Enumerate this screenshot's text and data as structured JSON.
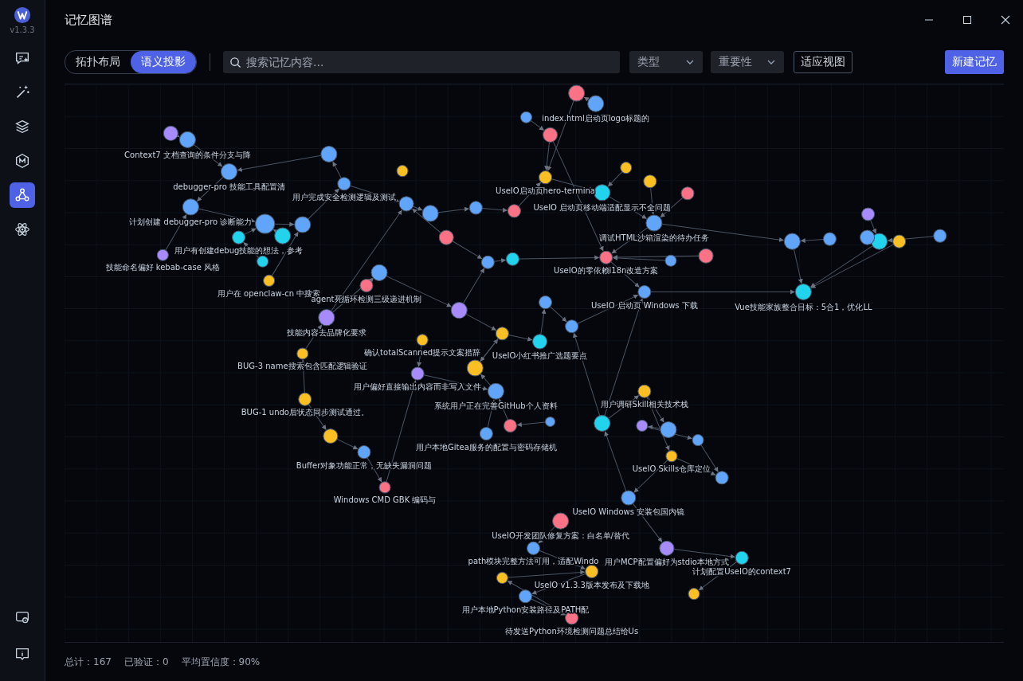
{
  "app": {
    "version": "v1.3.3"
  },
  "sidebar": {
    "items": [
      {
        "kind": "chat",
        "selected": false
      },
      {
        "kind": "wand",
        "selected": false
      },
      {
        "kind": "layers",
        "selected": false
      },
      {
        "kind": "badge",
        "selected": false
      },
      {
        "kind": "graph",
        "selected": true
      },
      {
        "kind": "atom",
        "selected": false
      }
    ],
    "bottom_items": [
      {
        "kind": "settings"
      },
      {
        "kind": "info"
      }
    ]
  },
  "window": {
    "title": "记忆图谱"
  },
  "toolbar": {
    "layout_toggle": [
      {
        "label": "拓扑布局",
        "selected": false
      },
      {
        "label": "语义投影",
        "selected": true
      }
    ],
    "search": {
      "placeholder": "搜索记忆内容..."
    },
    "filters": [
      {
        "label": "类型"
      },
      {
        "label": "重要性"
      }
    ],
    "fit_button": "适应视图",
    "new_button": "新建记忆"
  },
  "graph": {
    "nodes": [
      {
        "label": "index.html启动页logo标题的",
        "color": "#60a5fa"
      },
      {
        "label": "Context7 文档查询的条件分支与降",
        "color": "#60a5fa"
      },
      {
        "label": "debugger-pro 技能工具配置清",
        "color": "#60a5fa"
      },
      {
        "label": "UseIO启动页hero-termina",
        "color": "#fbbf24"
      },
      {
        "label": "用户完成安全检测逻辑及测试",
        "color": "#60a5fa"
      },
      {
        "label": "UseIO 启动页移动端适配显示不全问题",
        "color": "#22d3ee"
      },
      {
        "label": "计划创建 debugger-pro 诊断能力",
        "color": "#60a5fa"
      },
      {
        "label": "调试HTML沙箱渲染的待办任务",
        "color": "#60a5fa"
      },
      {
        "label": "用户有创建debug技能的想法，参考",
        "color": "#22d3ee"
      },
      {
        "label": "技能命名偏好 kebab-case 风格",
        "color": "#a78bfa"
      },
      {
        "label": "UseIO的零依赖i18n改造方案",
        "color": "#fb7185"
      },
      {
        "label": "用户在 openclaw-cn 中搜索",
        "color": "#fbbf24"
      },
      {
        "label": "agent死循环检测三级递进机制",
        "color": "#fb7185"
      },
      {
        "label": "UseIO 启动页 Windows 下载",
        "color": "#60a5fa"
      },
      {
        "label": "Vue技能家族整合目标：5合1，优化LL",
        "color": "#22d3ee"
      },
      {
        "label": "技能内容去品牌化要求",
        "color": "#a78bfa"
      },
      {
        "label": "确认totalScanned提示文案措辞",
        "color": "#fbbf24"
      },
      {
        "label": "UseIO小红书推广选题要点",
        "color": "#22d3ee"
      },
      {
        "label": "BUG-3 name搜索包含匹配逻辑验证",
        "color": "#fbbf24"
      },
      {
        "label": "用户偏好直接输出内容而非写入文件",
        "color": "#a78bfa"
      },
      {
        "label": "系统用户正在完善GitHub个人资料",
        "color": "#60a5fa"
      },
      {
        "label": "用户调研Skill相关技术栈",
        "color": "#fbbf24"
      },
      {
        "label": "BUG-1 undo后状态同步测试通过。",
        "color": "#fbbf24"
      },
      {
        "label": "用户本地Gitea服务的配置与密码存储机",
        "color": "#60a5fa"
      },
      {
        "label": "Buffer对象功能正常，无缺失漏洞问题",
        "color": "#60a5fa"
      },
      {
        "label": "UseIO Skills仓库定位",
        "color": "#fbbf24"
      },
      {
        "label": "Windows CMD GBK 编码与",
        "color": "#fb7185"
      },
      {
        "label": "UseIO Windows 安装包国内镜",
        "color": "#60a5fa"
      },
      {
        "label": "UseIO开发团队修复方案：白名单/替代",
        "color": "#fb7185"
      },
      {
        "label": "path模块完整方法可用，适配Windo",
        "color": "#60a5fa"
      },
      {
        "label": "用户MCP配置偏好为stdio本地方式",
        "color": "#a78bfa"
      },
      {
        "label": "计划配置UseIO的context7",
        "color": "#22d3ee"
      },
      {
        "label": "UseIO v1.3.3版本发布及下载地",
        "color": "#fbbf24"
      },
      {
        "label": "用户本地Python安装路径及PATH配",
        "color": "#60a5fa"
      },
      {
        "label": "待发送Python环境检测问题总结给Us",
        "color": "#fb7185"
      },
      {
        "color": "#22d3ee"
      },
      {
        "color": "#60a5fa"
      },
      {
        "color": "#60a5fa"
      },
      {
        "color": "#60a5fa"
      },
      {
        "color": "#60a5fa"
      },
      {
        "color": "#60a5fa"
      },
      {
        "color": "#fbbf24"
      },
      {
        "color": "#60a5fa"
      },
      {
        "color": "#fb7185"
      },
      {
        "color": "#fb7185"
      },
      {
        "color": "#60a5fa"
      },
      {
        "color": "#fb7185"
      },
      {
        "color": "#fbbf24"
      },
      {
        "color": "#fbbf24"
      },
      {
        "color": "#fb7185"
      },
      {
        "color": "#60a5fa"
      },
      {
        "color": "#fb7185"
      },
      {
        "color": "#60a5fa"
      },
      {
        "color": "#60a5fa"
      },
      {
        "color": "#a78bfa"
      },
      {
        "color": "#22d3ee"
      },
      {
        "color": "#fbbf24"
      },
      {
        "color": "#fbbf24"
      },
      {
        "color": "#60a5fa"
      },
      {
        "color": "#60a5fa"
      },
      {
        "color": "#a78bfa"
      },
      {
        "color": "#60a5fa"
      },
      {
        "color": "#22d3ee"
      },
      {
        "color": "#fbbf24"
      },
      {
        "color": "#fb7185"
      },
      {
        "color": "#60a5fa"
      },
      {
        "color": "#fb7185"
      },
      {
        "color": "#60a5fa"
      },
      {
        "color": "#a78bfa"
      },
      {
        "color": "#60a5fa"
      },
      {
        "color": "#60a5fa"
      },
      {
        "color": "#fbbf24"
      },
      {
        "color": "#fbbf24"
      },
      {
        "color": "#fbbf24"
      },
      {
        "color": "#a78bfa"
      },
      {
        "color": "#22d3ee"
      },
      {
        "color": "#22d3ee"
      },
      {
        "color": "#60a5fa"
      },
      {
        "color": "#60a5fa"
      },
      {
        "color": "#60a5fa"
      }
    ]
  },
  "status_bar": [
    {
      "label": "总计：167"
    },
    {
      "label": "已验证：0"
    },
    {
      "label": "平均置信度：90%"
    }
  ]
}
